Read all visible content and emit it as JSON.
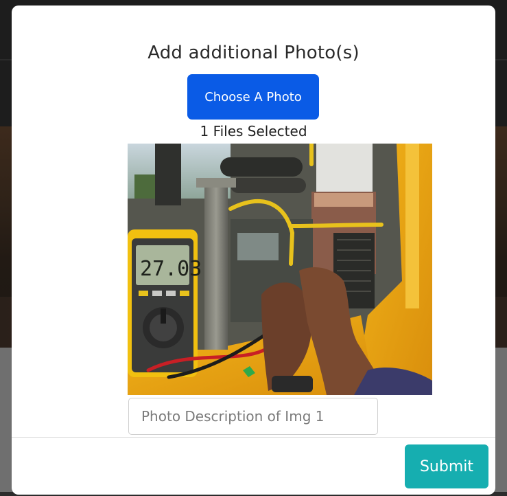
{
  "modal": {
    "title": "Add additional Photo(s)",
    "choose_label": "Choose A Photo",
    "files_selected": "1 Files Selected",
    "photo": {
      "meter_reading": "27.03"
    },
    "description": {
      "value": "",
      "placeholder": "Photo Description of Img 1"
    },
    "submit_label": "Submit"
  },
  "colors": {
    "choose_button": "#0a5be6",
    "submit_button": "#16aeb0",
    "modal_background": "#ffffff"
  }
}
